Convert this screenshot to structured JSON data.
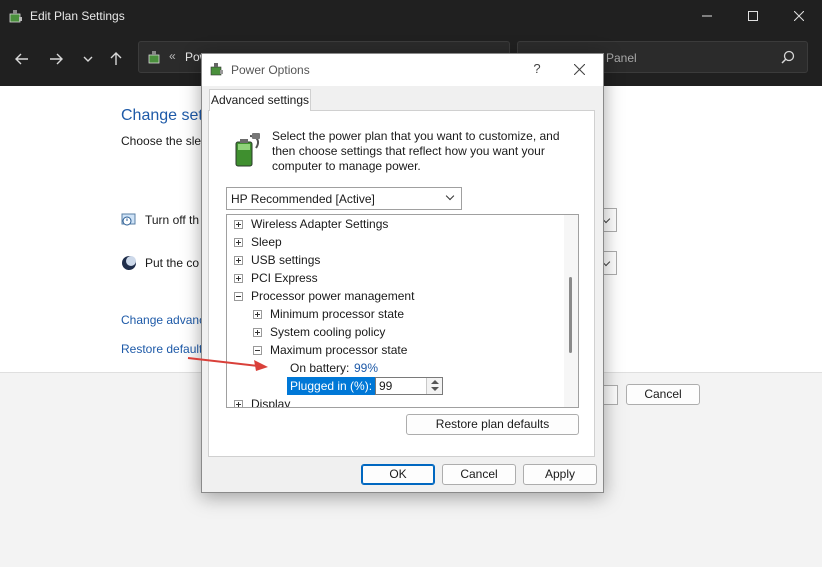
{
  "background_window": {
    "title": "Edit Plan Settings",
    "address_path": "Pow",
    "search_text": "Panel",
    "heading": "Change sett",
    "subheading": "Choose the slee",
    "row_display_off": "Turn off th",
    "row_sleep": "Put the co",
    "link_advanced": "Change advanc",
    "link_restore": "Restore default",
    "cancel_label": "Cancel"
  },
  "dialog": {
    "title": "Power Options",
    "help": "?",
    "tab_label": "Advanced settings",
    "intro_text": "Select the power plan that you want to customize, and then choose settings that reflect how you want your computer to manage power.",
    "plan_selected": "HP Recommended [Active]",
    "tree": [
      {
        "label": "Wireless Adapter Settings",
        "expanded": false
      },
      {
        "label": "Sleep",
        "expanded": false
      },
      {
        "label": "USB settings",
        "expanded": false
      },
      {
        "label": "PCI Express",
        "expanded": false
      },
      {
        "label": "Processor power management",
        "expanded": true
      },
      {
        "label": "Minimum processor state",
        "expanded": false
      },
      {
        "label": "System cooling policy",
        "expanded": false
      },
      {
        "label": "Maximum processor state",
        "expanded": true
      },
      {
        "label": "On battery:",
        "value": "99%"
      },
      {
        "label": "Plugged in (%):",
        "value": "99"
      },
      {
        "label": "Display",
        "expanded": false
      }
    ],
    "restore_label": "Restore plan defaults",
    "ok_label": "OK",
    "cancel_label": "Cancel",
    "apply_label": "Apply"
  },
  "colors": {
    "accent": "#0078d7",
    "link": "#1e5aa8",
    "annotation_arrow": "#d9403a"
  }
}
